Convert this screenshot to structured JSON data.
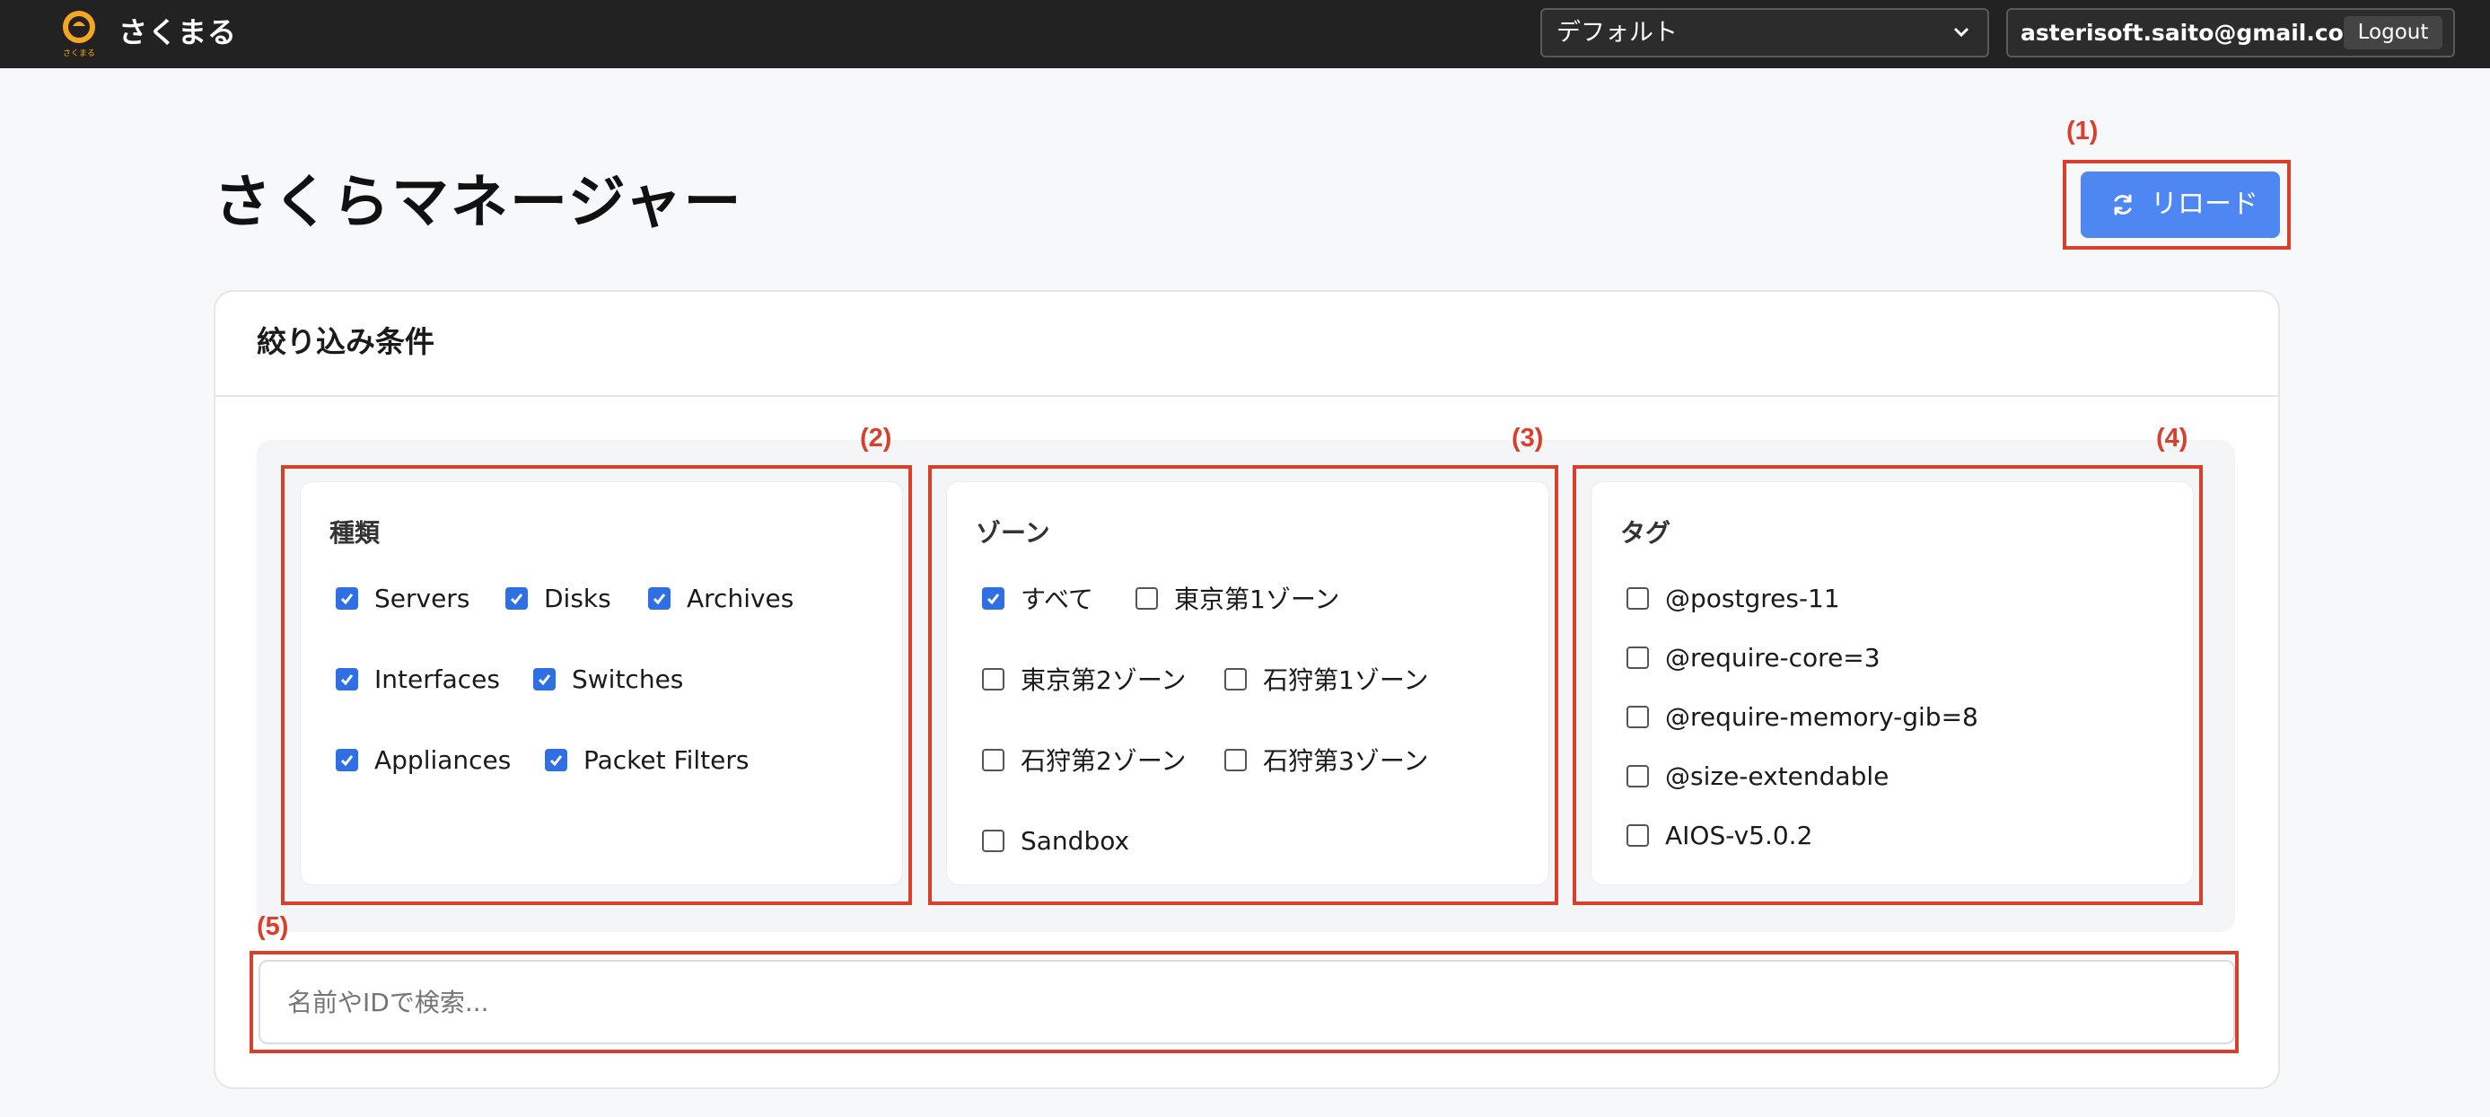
{
  "navbar": {
    "brand": "さくまる",
    "logo_caption": "さくまる",
    "environment_selected": "デフォルト",
    "user_email": "asterisoft.saito@gmail.com",
    "logout_label": "Logout"
  },
  "page": {
    "title": "さくらマネージャー",
    "reload_label": "リロード"
  },
  "filters": {
    "title": "絞り込み条件",
    "types": {
      "title": "種類",
      "items": [
        {
          "label": "Servers",
          "checked": true
        },
        {
          "label": "Disks",
          "checked": true
        },
        {
          "label": "Archives",
          "checked": true
        },
        {
          "label": "Interfaces",
          "checked": true
        },
        {
          "label": "Switches",
          "checked": true
        },
        {
          "label": "Appliances",
          "checked": true
        },
        {
          "label": "Packet Filters",
          "checked": true
        }
      ]
    },
    "zones": {
      "title": "ゾーン",
      "items": [
        {
          "label": "すべて",
          "checked": true
        },
        {
          "label": "東京第1ゾーン",
          "checked": false
        },
        {
          "label": "東京第2ゾーン",
          "checked": false
        },
        {
          "label": "石狩第1ゾーン",
          "checked": false
        },
        {
          "label": "石狩第2ゾーン",
          "checked": false
        },
        {
          "label": "石狩第3ゾーン",
          "checked": false
        },
        {
          "label": "Sandbox",
          "checked": false
        }
      ]
    },
    "tags": {
      "title": "タグ",
      "items": [
        {
          "label": "@postgres-11",
          "checked": false
        },
        {
          "label": "@require-core=3",
          "checked": false
        },
        {
          "label": "@require-memory-gib=8",
          "checked": false
        },
        {
          "label": "@size-extendable",
          "checked": false
        },
        {
          "label": "AIOS-v5.0.2",
          "checked": false
        }
      ]
    },
    "search_placeholder": "名前やIDで検索..."
  },
  "annotations": [
    "(1)",
    "(2)",
    "(3)",
    "(4)",
    "(5)"
  ],
  "colors": {
    "navbar_bg": "#222222",
    "accent_blue": "#4f87f2",
    "checkbox_blue": "#2f6fe4",
    "annotation_red": "#d9402b",
    "logo_orange": "#f5a623"
  }
}
